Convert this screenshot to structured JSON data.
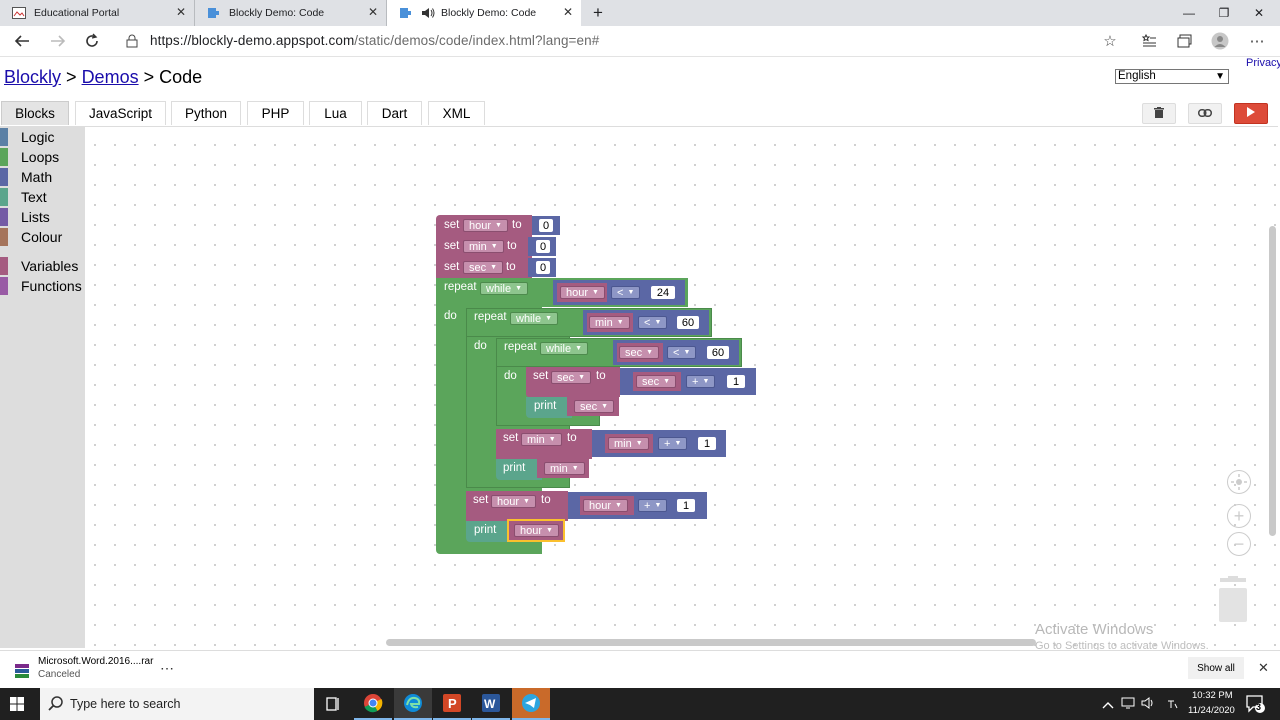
{
  "browser": {
    "tabs": [
      {
        "title": "Educational Portal",
        "icon": "portal-favicon-icon"
      },
      {
        "title": "Blockly Demo: Code",
        "icon": "blockly-favicon-icon"
      },
      {
        "title": "Blockly Demo: Code",
        "icon": "blockly-favicon-icon",
        "active": true
      }
    ],
    "url_main": "https://blockly-demo.appspot.com",
    "url_rest": "/static/demos/code/index.html?lang=en#"
  },
  "page": {
    "crumb_blockly": "Blockly",
    "sep1": ">",
    "crumb_demos": "Demos",
    "sep2": ">",
    "crumb_code": "Code",
    "privacy": "Privacy",
    "language": "English",
    "tabs": [
      "Blocks",
      "JavaScript",
      "Python",
      "PHP",
      "Lua",
      "Dart",
      "XML"
    ]
  },
  "toolbox": [
    {
      "label": "Logic",
      "color": "#5b80a5"
    },
    {
      "label": "Loops",
      "color": "#5ba55b"
    },
    {
      "label": "Math",
      "color": "#5b67a5"
    },
    {
      "label": "Text",
      "color": "#5ba58c"
    },
    {
      "label": "Lists",
      "color": "#745ba5"
    },
    {
      "label": "Colour",
      "color": "#a5745b"
    },
    {
      "label": "Variables",
      "color": "#a55b80"
    },
    {
      "label": "Functions",
      "color": "#995ba5"
    }
  ],
  "blocks": {
    "set": "set",
    "to": "to",
    "repeat": "repeat",
    "do": "do",
    "print": "print",
    "while": "while",
    "var_hour": "hour",
    "var_min": "min",
    "var_sec": "sec",
    "op_lt": "<",
    "op_plus": "+",
    "zero": "0",
    "one": "1",
    "twenty_four": "24",
    "sixty": "60"
  },
  "watermark": {
    "line1": "Activate Windows",
    "line2": "Go to Settings to activate Windows."
  },
  "download": {
    "filename": "Microsoft.Word.2016....rar",
    "status": "Canceled",
    "more": "⋯",
    "show_all": "Show all"
  },
  "taskbar": {
    "search_placeholder": "Type here to search",
    "time": "10:32 PM",
    "date": "11/24/2020",
    "notifications": "3"
  },
  "colors": {
    "loops": "#5ba55b",
    "variables": "#a55b80",
    "math": "#5b67a5",
    "text": "#5ba58c",
    "selected_outline": "#fbc02d"
  }
}
